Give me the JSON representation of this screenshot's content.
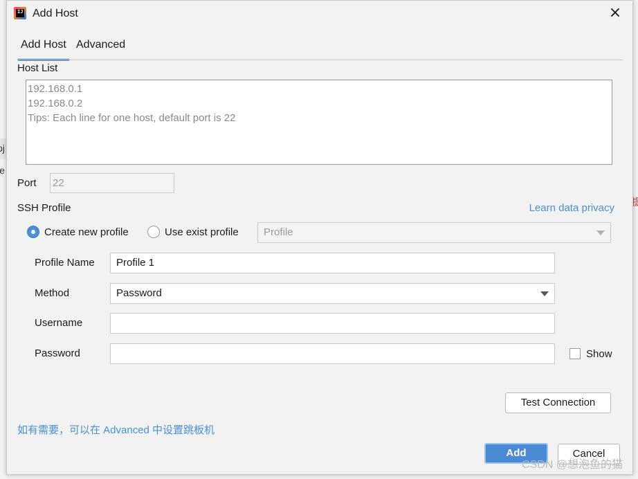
{
  "window": {
    "title": "Add Host",
    "icon": "intellij-app-icon",
    "icon_text": "IJ"
  },
  "tabs": [
    {
      "label": "Add Host",
      "active": true
    },
    {
      "label": "Advanced",
      "active": false
    }
  ],
  "host_list": {
    "label": "Host List",
    "placeholder_lines": "192.168.0.1\n192.168.0.2\nTips: Each line for one host, default port is 22"
  },
  "port": {
    "label": "Port",
    "placeholder": "22"
  },
  "ssh_profile": {
    "label": "SSH Profile",
    "privacy_link": "Learn data privacy",
    "create_new_label": "Create new profile",
    "use_exist_label": "Use exist profile",
    "profile_select_placeholder": "Profile",
    "selected_option": "create_new"
  },
  "form": {
    "profile_name": {
      "label": "Profile Name",
      "value": "Profile 1"
    },
    "method": {
      "label": "Method",
      "value": "Password"
    },
    "username": {
      "label": "Username",
      "value": ""
    },
    "password": {
      "label": "Password",
      "value": ""
    },
    "show_label": "Show"
  },
  "buttons": {
    "test_connection": "Test Connection",
    "add": "Add",
    "cancel": "Cancel"
  },
  "hint": "如有需要，可以在 Advanced 中设置跳板机",
  "watermark": "CSDN @想泡鱼的猫",
  "background_fragments": {
    "left_1": "oj",
    "left_2": "le",
    "right_1": "提"
  },
  "colors": {
    "accent": "#4a8ad4",
    "link": "#4a90d9",
    "tab_underline": "#4083c9"
  }
}
